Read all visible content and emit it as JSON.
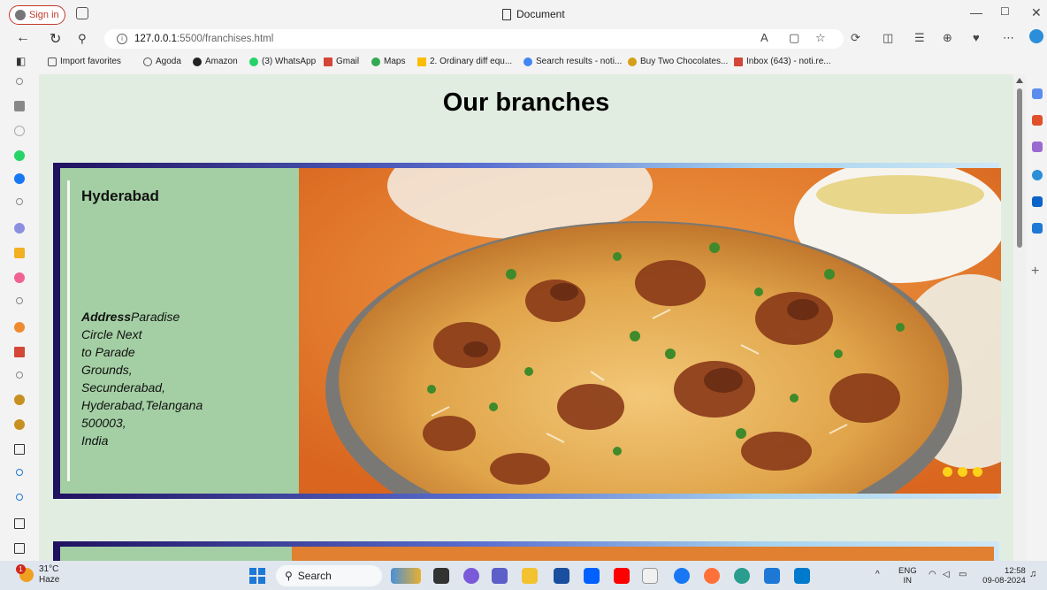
{
  "titlebar": {
    "signin_label": "Sign in",
    "document_title": "Document",
    "minimize": "—",
    "restore": "☐",
    "close": "✕"
  },
  "address": {
    "url_host": "127.0.0.1",
    "url_path": ":5500/franchises.html",
    "info_glyph": "i"
  },
  "bookmarks": [
    {
      "label": "Import favorites",
      "icon": "import-icon"
    },
    {
      "label": "Agoda",
      "icon": "agoda-icon"
    },
    {
      "label": "Amazon",
      "icon": "amazon-icon"
    },
    {
      "label": "(3) WhatsApp",
      "icon": "whatsapp-icon"
    },
    {
      "label": "Gmail",
      "icon": "gmail-icon"
    },
    {
      "label": "Maps",
      "icon": "maps-icon"
    },
    {
      "label": "2. Ordinary diff equ...",
      "icon": "drive-icon"
    },
    {
      "label": "Search results - noti...",
      "icon": "google-icon"
    },
    {
      "label": "Buy Two Chocolates...",
      "icon": "chocolate-icon"
    },
    {
      "label": "Inbox (643) - noti.re...",
      "icon": "gmail-icon"
    }
  ],
  "page": {
    "title": "Our branches",
    "branch": {
      "city": "Hyderabad",
      "address_label": "Address",
      "address_lines": [
        "Paradise",
        "Circle Next",
        "to Parade",
        "Grounds,",
        "Secunderabad,",
        "Hyderabad,Telangana",
        "500003,",
        "India"
      ]
    }
  },
  "taskbar": {
    "temperature": "31°C",
    "weather": "Haze",
    "notification_count": "1",
    "search_label": "Search",
    "language_top": "ENG",
    "language_bottom": "IN",
    "time": "12:58",
    "date": "09-08-2024"
  },
  "colors": {
    "page_bg": "#e2ede2",
    "info_panel": "#a4cfa4",
    "dots": "#ffd21a",
    "signin_accent": "#c0392b"
  }
}
